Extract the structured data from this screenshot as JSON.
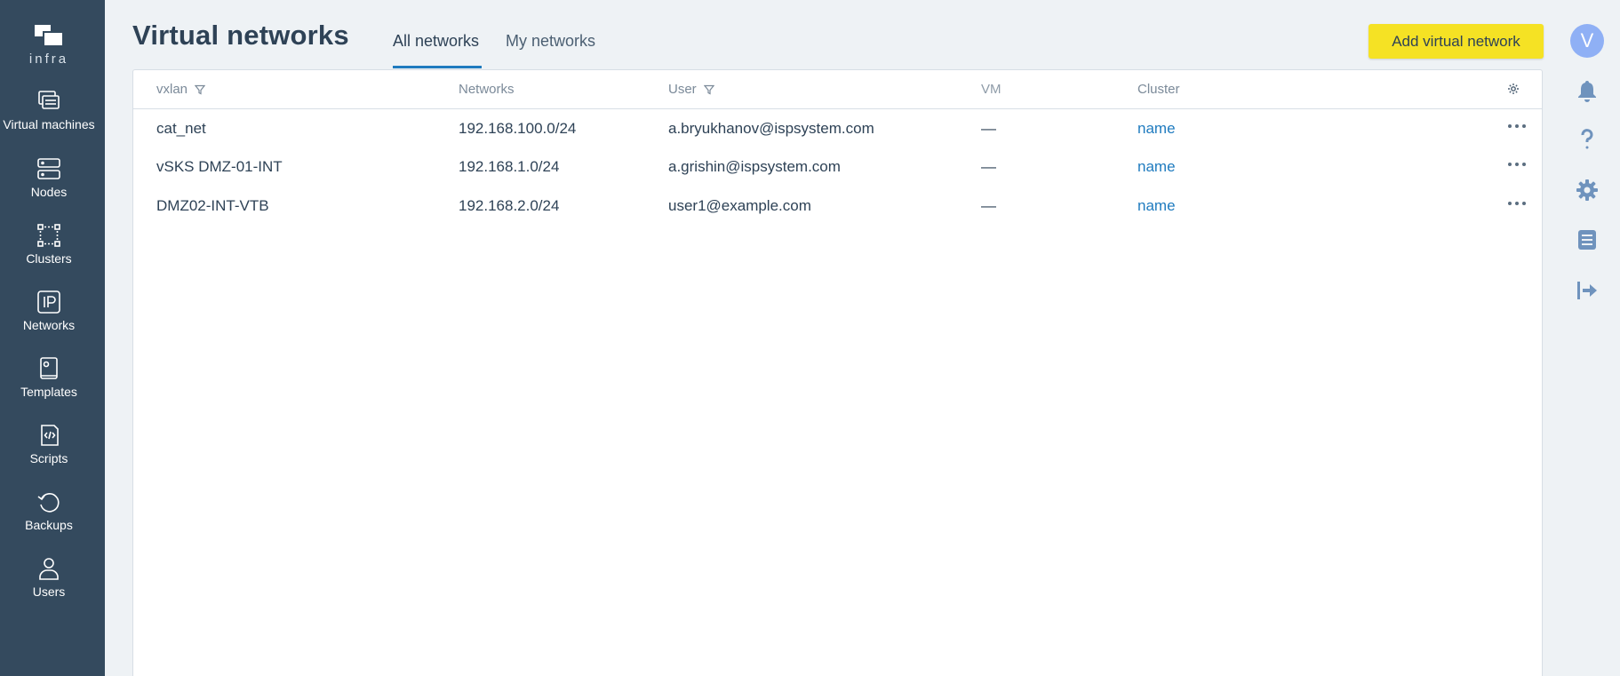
{
  "sidebar": {
    "logo_text": "infra",
    "items": [
      {
        "label": "Virtual machines",
        "icon": "virtual-machines-icon"
      },
      {
        "label": "Nodes",
        "icon": "nodes-icon"
      },
      {
        "label": "Clusters",
        "icon": "clusters-icon"
      },
      {
        "label": "Networks",
        "icon": "ip-icon"
      },
      {
        "label": "Templates",
        "icon": "templates-icon"
      },
      {
        "label": "Scripts",
        "icon": "scripts-icon"
      },
      {
        "label": "Backups",
        "icon": "backups-icon"
      },
      {
        "label": "Users",
        "icon": "users-icon"
      }
    ]
  },
  "header": {
    "title": "Virtual networks",
    "tabs": [
      {
        "label": "All networks",
        "active": true
      },
      {
        "label": "My networks",
        "active": false
      }
    ],
    "add_button_label": "Add virtual network"
  },
  "table": {
    "columns": [
      "vxlan",
      "Networks",
      "User",
      "VM",
      "Cluster"
    ],
    "rows": [
      {
        "vxlan": "cat_net",
        "networks": "192.168.100.0/24",
        "user": "a.bryukhanov@ispsystem.com",
        "vm": "—",
        "cluster": "name"
      },
      {
        "vxlan": "vSKS DMZ-01-INT",
        "networks": "192.168.1.0/24",
        "user": "a.grishin@ispsystem.com",
        "vm": "—",
        "cluster": "name"
      },
      {
        "vxlan": "DMZ02-INT-VTB",
        "networks": "192.168.2.0/24",
        "user": "user1@example.com",
        "vm": "—",
        "cluster": "name"
      }
    ]
  },
  "rail": {
    "avatar_letter": "V",
    "icons": [
      "bell-icon",
      "help-icon",
      "settings-icon",
      "list-icon",
      "logout-icon"
    ]
  },
  "colors": {
    "sidebar_bg": "#344a5e",
    "page_bg": "#eef2f5",
    "accent": "#1f7bbf",
    "button_yellow": "#f5e224",
    "avatar": "#8fb0f5",
    "rail_icon": "#6f93bd"
  }
}
